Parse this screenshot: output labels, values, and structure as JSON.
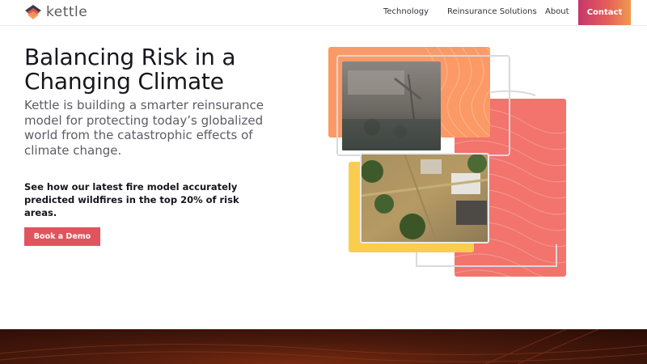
{
  "brand": {
    "name": "kettle"
  },
  "nav": {
    "items": [
      "Technology",
      "Reinsurance Solutions",
      "About"
    ],
    "contact_label": "Contact"
  },
  "hero": {
    "title": "Balancing Risk in a Changing Climate",
    "subtitle": "Kettle is building a smarter reinsurance model for protecting today’s globalized world from the catastrophic effects of climate change.",
    "callout": "See how our latest fire model accurately predicted wildfires in the top 20% of risk areas.",
    "cta_label": "Book a Demo"
  },
  "colors": {
    "accent": "#e0545e",
    "orange": "#fb9a67",
    "coral": "#f2746c",
    "yellow": "#fbcd4e",
    "contact_gradient": [
      "#c7356b",
      "#f1994f"
    ]
  },
  "icons": [
    "kettle-logo-icon"
  ]
}
